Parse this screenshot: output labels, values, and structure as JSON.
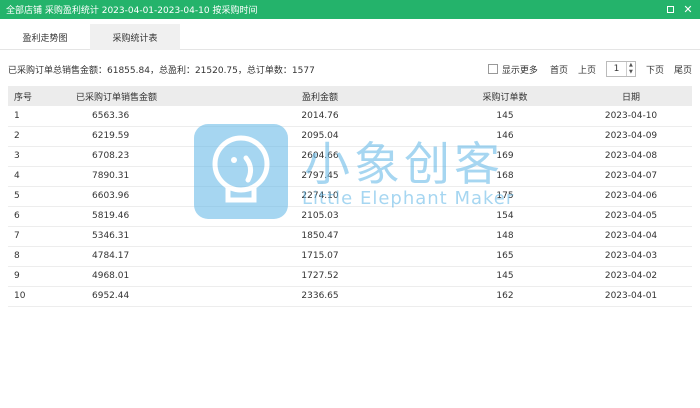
{
  "window": {
    "title": "全部店铺 采购盈利统计 2023-04-01-2023-04-10 按采购时间",
    "maximize_icon": "maximize-icon",
    "close_icon": "close-icon"
  },
  "tabs": [
    {
      "label": "盈利走势图",
      "active": false
    },
    {
      "label": "采购统计表",
      "active": true
    }
  ],
  "summary": "已采购订单总销售金额：61855.84，总盈利：21520.75，总订单数：1577",
  "pager": {
    "show_more_label": "显示更多",
    "first_label": "首页",
    "prev_label": "上页",
    "page": "1",
    "next_label": "下页",
    "last_label": "尾页"
  },
  "table": {
    "headers": [
      "序号",
      "已采购订单销售金额",
      "盈利金额",
      "采购订单数",
      "日期"
    ],
    "rows": [
      [
        "1",
        "6563.36",
        "2014.76",
        "145",
        "2023-04-10"
      ],
      [
        "2",
        "6219.59",
        "2095.04",
        "146",
        "2023-04-09"
      ],
      [
        "3",
        "6708.23",
        "2604.66",
        "169",
        "2023-04-08"
      ],
      [
        "4",
        "7890.31",
        "2797.45",
        "168",
        "2023-04-07"
      ],
      [
        "5",
        "6603.96",
        "2274.10",
        "175",
        "2023-04-06"
      ],
      [
        "6",
        "5819.46",
        "2105.03",
        "154",
        "2023-04-05"
      ],
      [
        "7",
        "5346.31",
        "1850.47",
        "148",
        "2023-04-04"
      ],
      [
        "8",
        "4784.17",
        "1715.07",
        "165",
        "2023-04-03"
      ],
      [
        "9",
        "4968.01",
        "1727.52",
        "145",
        "2023-04-02"
      ],
      [
        "10",
        "6952.44",
        "2336.65",
        "162",
        "2023-04-01"
      ]
    ]
  },
  "watermark": {
    "cn": "小象创客",
    "en": "Little Elephant Maker",
    "color": "#5fb6e6"
  },
  "colors": {
    "titlebar": "#24b36b"
  }
}
